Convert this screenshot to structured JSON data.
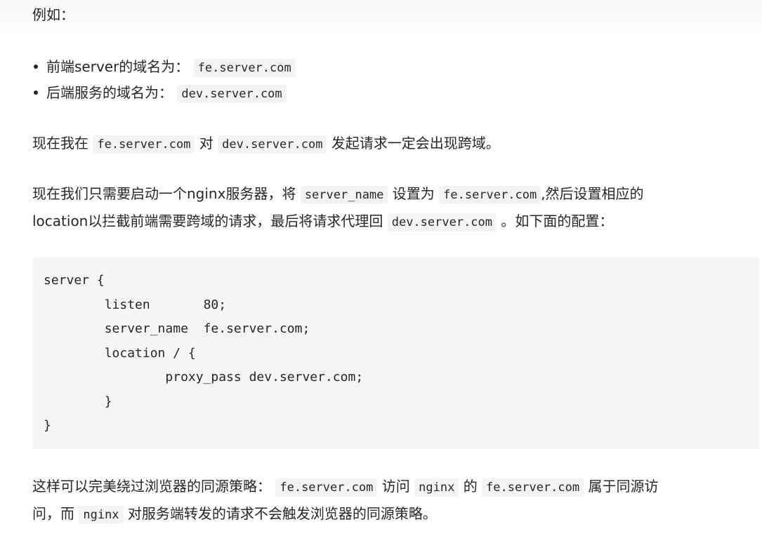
{
  "intro": {
    "text": "例如："
  },
  "bullets": [
    {
      "text": "前端server的域名为：",
      "code": "fe.server.com"
    },
    {
      "text": "后端服务的域名为：",
      "code": "dev.server.com"
    }
  ],
  "para1": {
    "t1": "现在我在",
    "c1": "fe.server.com",
    "t2": "对",
    "c2": "dev.server.com",
    "t3": "发起请求一定会出现跨域。"
  },
  "para2": {
    "t1": "现在我们只需要启动一个nginx服务器，将",
    "c1": "server_name",
    "t2": "设置为",
    "c2": "fe.server.com",
    "t3": ",然后设置相应的",
    "t4": "location以拦截前端需要跨域的请求，最后将请求代理回",
    "c3": "dev.server.com",
    "t5": "。如下面的配置："
  },
  "code_block": {
    "lines": [
      "server {",
      "        listen       80;",
      "        server_name  fe.server.com;",
      "        location / {",
      "                proxy_pass dev.server.com;",
      "        }",
      "}"
    ]
  },
  "para3": {
    "t1": "这样可以完美绕过浏览器的同源策略：",
    "c1": "fe.server.com",
    "t2": "访问",
    "c2": "nginx",
    "t3": "的",
    "c3": "fe.server.com",
    "t4": "属于同源访",
    "t5": "问，而",
    "c4": "nginx",
    "t6": "对服务端转发的请求不会触发浏览器的同源策略。"
  }
}
